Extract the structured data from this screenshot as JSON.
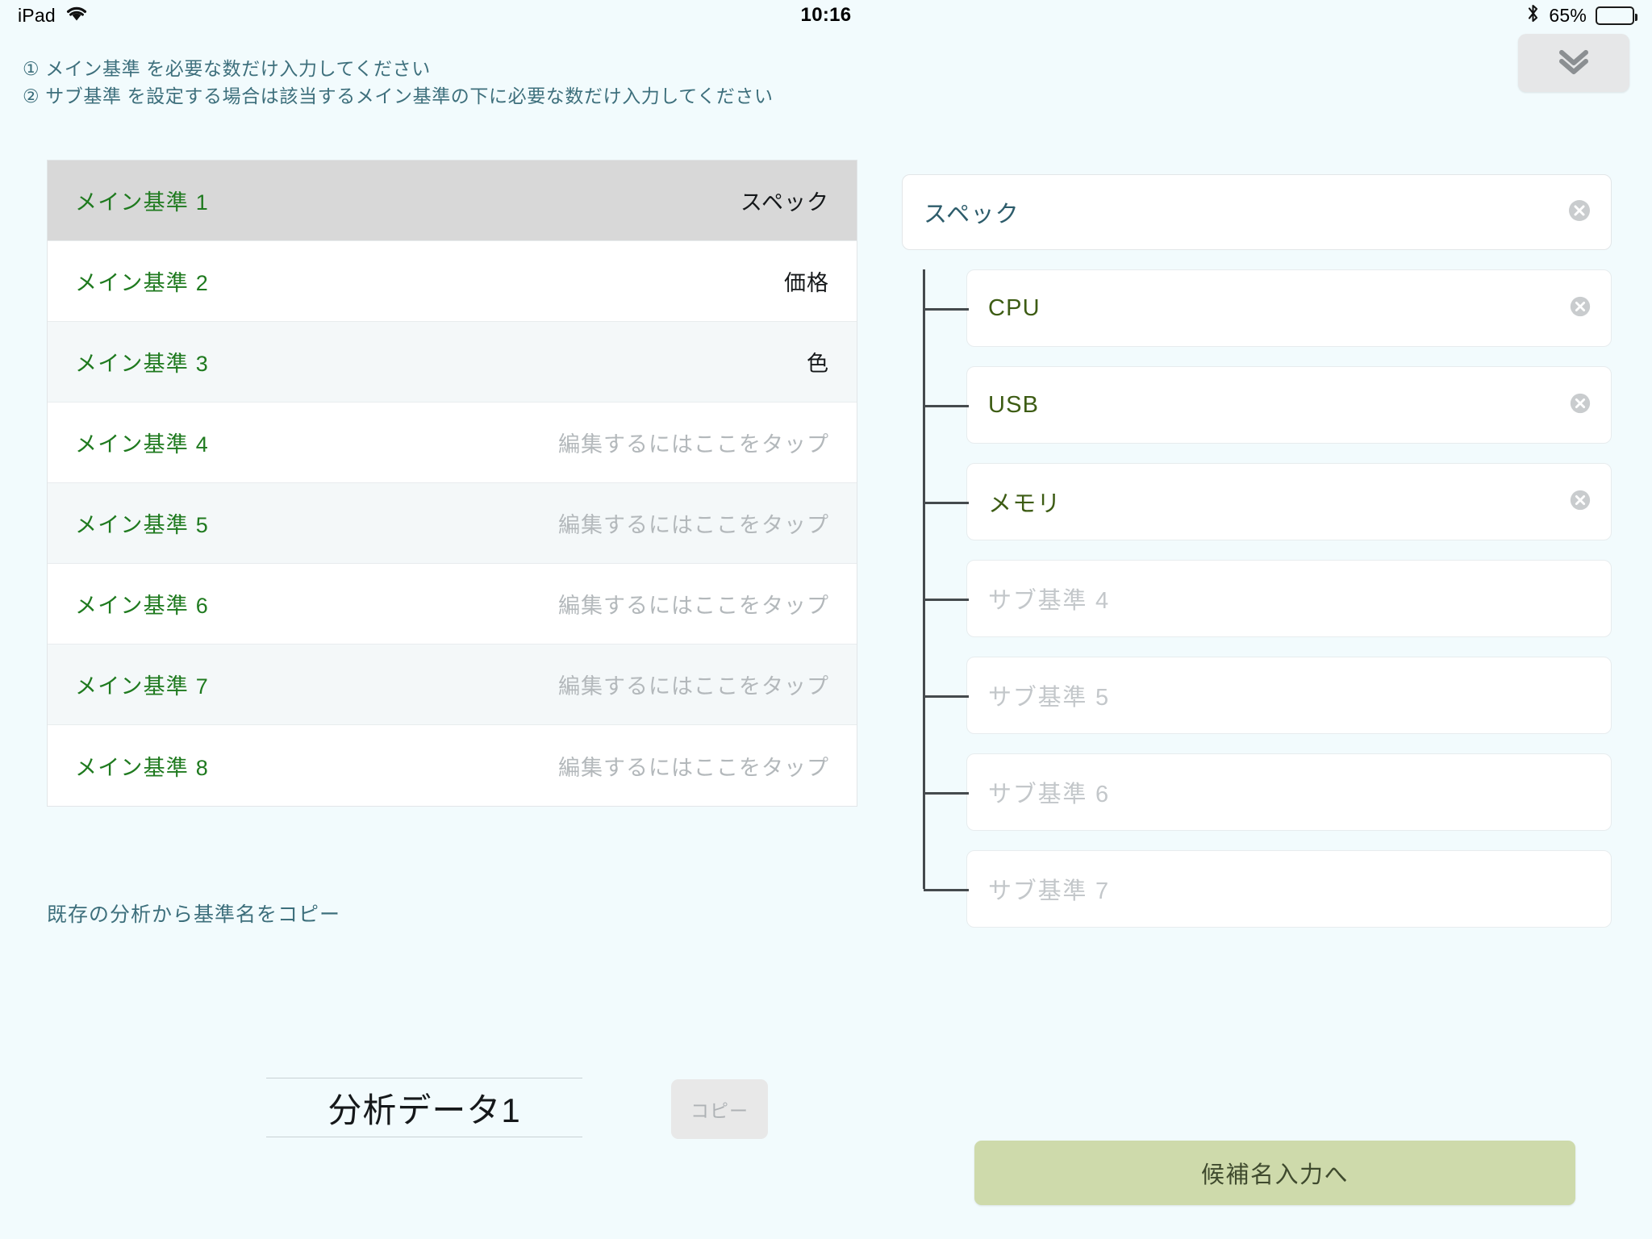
{
  "status_bar": {
    "device": "iPad",
    "wifi_icon": "wifi-icon",
    "time": "10:16",
    "bluetooth_icon": "bluetooth-icon",
    "battery_percent": "65%",
    "battery_level": 65
  },
  "header": {
    "instruction_1": "① メイン基準 を必要な数だけ入力してください",
    "instruction_2": "② サブ基準 を設定する場合は該当するメイン基準の下に必要な数だけ入力してください",
    "collapse_icon": "chevron-double-down-icon"
  },
  "main_criteria": {
    "placeholder_hint": "編集するにはここをタップ",
    "rows": [
      {
        "label": "メイン基準 1",
        "value": "スペック",
        "is_placeholder": false,
        "selected": true
      },
      {
        "label": "メイン基準 2",
        "value": "価格",
        "is_placeholder": false,
        "selected": false
      },
      {
        "label": "メイン基準 3",
        "value": "色",
        "is_placeholder": false,
        "selected": false
      },
      {
        "label": "メイン基準 4",
        "value": "編集するにはここをタップ",
        "is_placeholder": true,
        "selected": false
      },
      {
        "label": "メイン基準 5",
        "value": "編集するにはここをタップ",
        "is_placeholder": true,
        "selected": false
      },
      {
        "label": "メイン基準 6",
        "value": "編集するにはここをタップ",
        "is_placeholder": true,
        "selected": false
      },
      {
        "label": "メイン基準 7",
        "value": "編集するにはここをタップ",
        "is_placeholder": true,
        "selected": false
      },
      {
        "label": "メイン基準 8",
        "value": "編集するにはここをタップ",
        "is_placeholder": true,
        "selected": false
      }
    ]
  },
  "copy_link": {
    "label": "既存の分析から基準名をコピー"
  },
  "analysis_name": {
    "value": "分析データ1",
    "copy_button_label": "コピー",
    "copy_button_disabled": true
  },
  "sub_criteria": {
    "parent_value": "スペック",
    "parent_clear_icon": "clear-circle-icon",
    "rows": [
      {
        "text": "CPU",
        "is_placeholder": false,
        "clear_icon": "clear-circle-icon"
      },
      {
        "text": "USB",
        "is_placeholder": false,
        "clear_icon": "clear-circle-icon"
      },
      {
        "text": "メモリ",
        "is_placeholder": false,
        "clear_icon": "clear-circle-icon"
      },
      {
        "text": "サブ基準 4",
        "is_placeholder": true,
        "clear_icon": ""
      },
      {
        "text": "サブ基準 5",
        "is_placeholder": true,
        "clear_icon": ""
      },
      {
        "text": "サブ基準 6",
        "is_placeholder": true,
        "clear_icon": ""
      },
      {
        "text": "サブ基準 7",
        "is_placeholder": true,
        "clear_icon": ""
      }
    ]
  },
  "primary_action": {
    "label": "候補名入力へ"
  },
  "colors": {
    "background": "#f2fbfd",
    "accent_green": "#1f7a1f",
    "sub_text_green": "#3d5c14",
    "teal_text": "#3d6f7c",
    "selected_row": "#d8d8d8",
    "primary_button": "#cedaab"
  }
}
